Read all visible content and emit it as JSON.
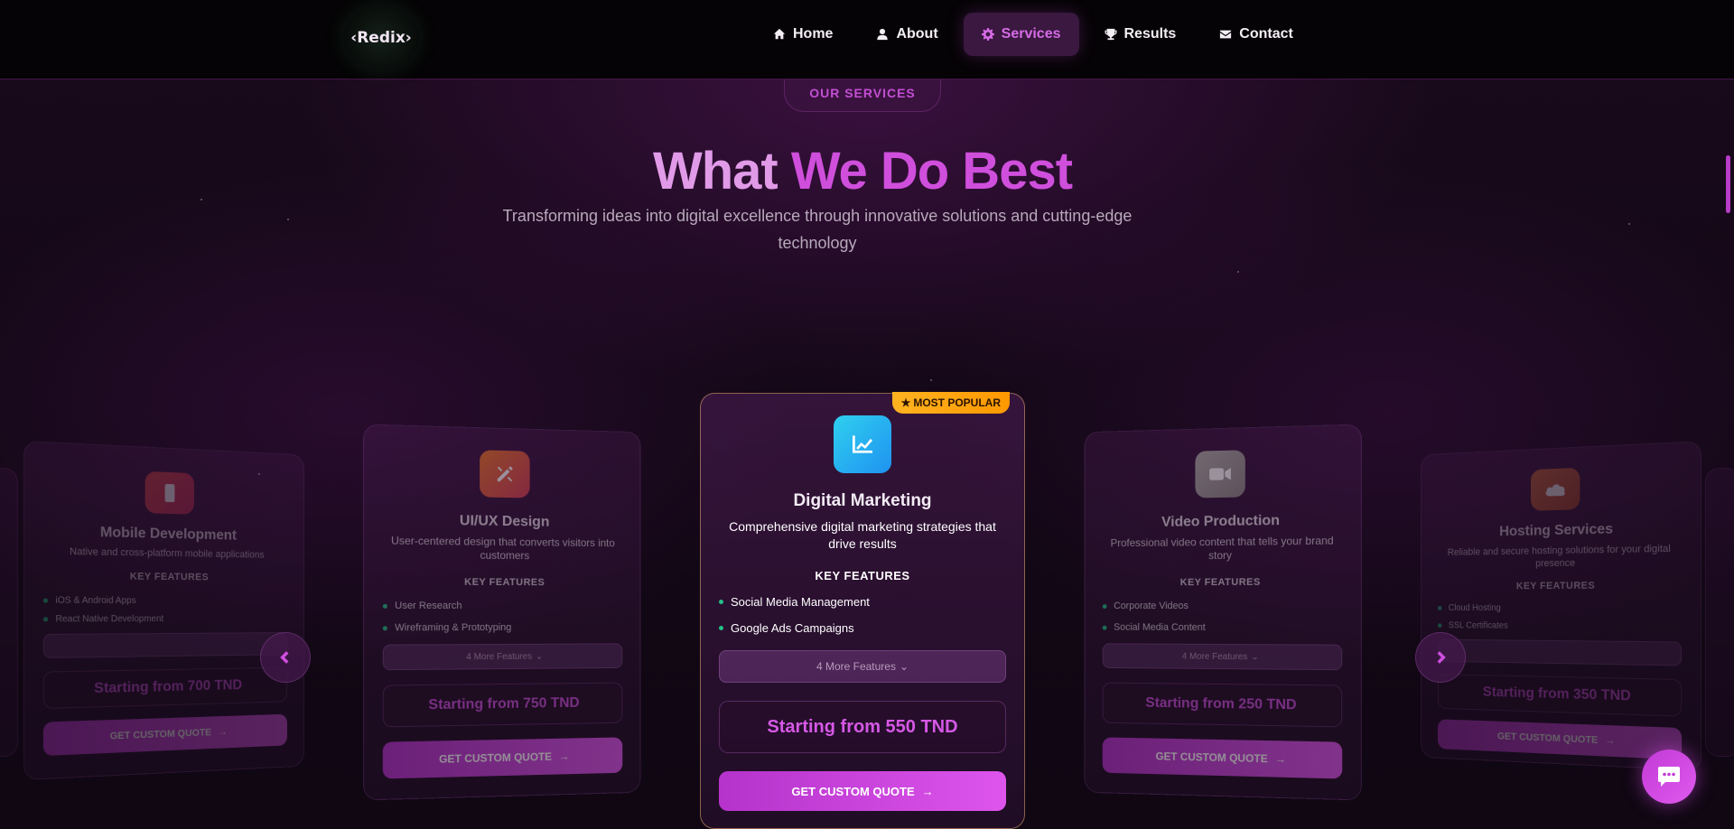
{
  "logo": {
    "text": "‹Redix›"
  },
  "nav": {
    "items": [
      {
        "label": "Home",
        "icon": "home-icon"
      },
      {
        "label": "About",
        "icon": "user-icon"
      },
      {
        "label": "Services",
        "icon": "gear-icon",
        "active": true
      },
      {
        "label": "Results",
        "icon": "trophy-icon"
      },
      {
        "label": "Contact",
        "icon": "envelope-icon"
      }
    ]
  },
  "hero": {
    "badge": "OUR SERVICES",
    "title_part1": "What ",
    "title_part2": "We Do Best",
    "subtitle": "Transforming ideas into digital excellence through innovative solutions and cutting-edge technology"
  },
  "cards": {
    "key_features_label": "KEY FEATURES",
    "quote_label": "GET CUSTOM QUOTE",
    "mobile": {
      "title": "Mobile Development",
      "desc": "Native and cross-platform mobile applications",
      "features": [
        "iOS & Android Apps",
        "React Native Development"
      ],
      "more": "",
      "price": "Starting from 700 TND"
    },
    "uiux": {
      "title": "UI/UX Design",
      "desc": "User-centered design that converts visitors into customers",
      "features": [
        "User Research",
        "Wireframing & Prototyping"
      ],
      "more": "4 More Features",
      "price": "Starting from 750 TND"
    },
    "marketing": {
      "badge": "MOST POPULAR",
      "title": "Digital Marketing",
      "desc": "Comprehensive digital marketing strategies that drive results",
      "features": [
        "Social Media Management",
        "Google Ads Campaigns"
      ],
      "more": "4 More Features",
      "price": "Starting from 550 TND"
    },
    "video": {
      "title": "Video Production",
      "desc": "Professional video content that tells your brand story",
      "features": [
        "Corporate Videos",
        "Social Media Content"
      ],
      "more": "4 More Features",
      "price": "Starting from 250 TND"
    },
    "hosting": {
      "title": "Hosting Services",
      "desc": "Reliable and secure hosting solutions for your digital presence",
      "features": [
        "Cloud Hosting",
        "SSL Certificates"
      ],
      "more": "",
      "price": "Starting from 350 TND"
    }
  },
  "colors": {
    "accent": "#cf4fdc",
    "popular": "#ffa614",
    "bullet": "#25c08a"
  }
}
